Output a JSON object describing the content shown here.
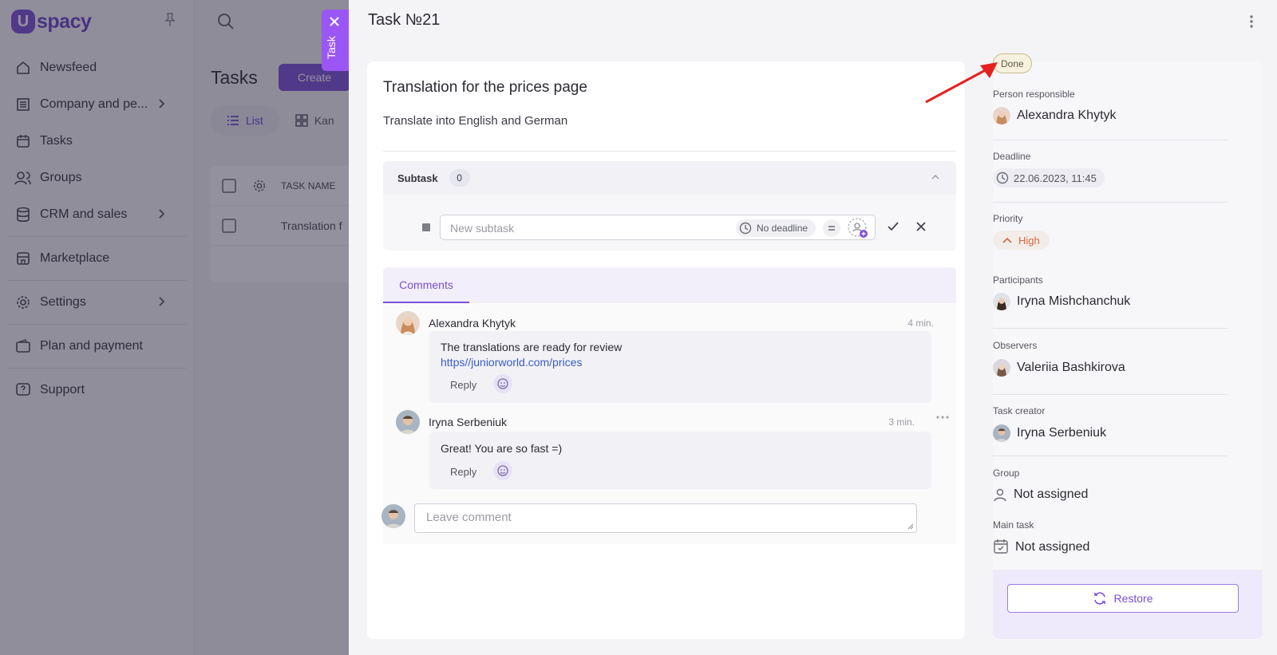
{
  "app": {
    "logo_letter": "U",
    "logo_text": "spacy",
    "page_title": "Tasks",
    "create_label": "Create",
    "view_tabs": [
      {
        "label": "List"
      },
      {
        "label": "Kan"
      }
    ],
    "table": {
      "header": "TASK NAME",
      "row": "Translation f"
    }
  },
  "sidebar": {
    "items": [
      {
        "label": "Newsfeed",
        "icon": "home-icon"
      },
      {
        "label": "Company and pe...",
        "icon": "building-icon"
      },
      {
        "label": "Tasks",
        "icon": "calendar-check-icon"
      },
      {
        "label": "Groups",
        "icon": "users-icon"
      },
      {
        "label": "CRM and sales",
        "icon": "database-icon"
      },
      {
        "label": "Marketplace",
        "icon": "store-icon"
      },
      {
        "label": "Settings",
        "icon": "gear-icon"
      },
      {
        "label": "Plan and payment",
        "icon": "wallet-icon"
      },
      {
        "label": "Support",
        "icon": "help-icon"
      }
    ]
  },
  "panel": {
    "tab_label": "Task",
    "title": "Task №21",
    "task_name": "Translation for the prices page",
    "description": "Translate into English and German",
    "subtask": {
      "label": "Subtask",
      "count": "0",
      "input_placeholder": "New subtask",
      "deadline_label": "No deadline"
    },
    "comments": {
      "tab_label": "Comments",
      "items": [
        {
          "author": "Alexandra Khytyk",
          "time": "4 min.",
          "text": "The translations are ready for review",
          "link": "https//juniorworld.com/prices",
          "reply": "Reply"
        },
        {
          "author": "Iryna Serbeniuk",
          "time": "3 min.",
          "text": "Great! You are so fast =)",
          "reply": "Reply"
        }
      ],
      "leave_placeholder": "Leave comment"
    }
  },
  "info": {
    "status": "Done",
    "person_responsible": {
      "label": "Person responsible",
      "value": "Alexandra Khytyk"
    },
    "deadline": {
      "label": "Deadline",
      "value": "22.06.2023, 11:45"
    },
    "priority": {
      "label": "Priority",
      "value": "High"
    },
    "participants": {
      "label": "Participants",
      "value": "Iryna Mishchanchuk"
    },
    "observers": {
      "label": "Observers",
      "value": "Valeriia Bashkirova"
    },
    "task_creator": {
      "label": "Task creator",
      "value": "Iryna Serbeniuk"
    },
    "group": {
      "label": "Group",
      "value": "Not assigned"
    },
    "main_task": {
      "label": "Main task",
      "value": "Not assigned"
    },
    "restore_label": "Restore"
  },
  "colors": {
    "accent": "#7b4fd6",
    "tab_purple": "#9b57f5",
    "priority_high": "#d4663a",
    "link": "#3a5bc7",
    "annotation_arrow": "#e5201f"
  }
}
